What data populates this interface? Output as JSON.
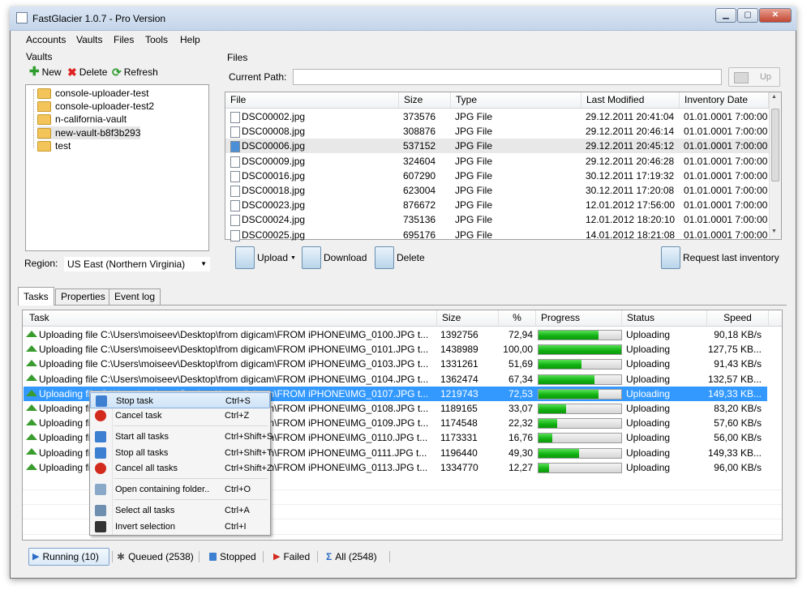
{
  "window": {
    "title": "FastGlacier 1.0.7 - Pro Version",
    "controls": {
      "minimize": "▁",
      "maximize": "▢",
      "close": "✕"
    }
  },
  "menu": [
    "Accounts",
    "Vaults",
    "Files",
    "Tools",
    "Help"
  ],
  "vaults": {
    "label": "Vaults",
    "toolbar": {
      "new": "New",
      "delete": "Delete",
      "refresh": "Refresh"
    },
    "items": [
      "console-uploader-test",
      "console-uploader-test2",
      "n-california-vault",
      "new-vault-b8f3b293",
      "test"
    ],
    "selected_index": 3,
    "region_label": "Region:",
    "region_value": "US East (Northern Virginia)"
  },
  "files": {
    "label": "Files",
    "current_path_label": "Current Path:",
    "current_path_value": "",
    "up_button": "Up",
    "columns": [
      "File",
      "Size",
      "Type",
      "Last Modified",
      "Inventory Date"
    ],
    "rows": [
      [
        "DSC00002.jpg",
        "373576",
        "JPG File",
        "29.12.2011 20:41:04",
        "01.01.0001 7:00:00"
      ],
      [
        "DSC00008.jpg",
        "308876",
        "JPG File",
        "29.12.2011 20:46:14",
        "01.01.0001 7:00:00"
      ],
      [
        "DSC00006.jpg",
        "537152",
        "JPG File",
        "29.12.2011 20:45:12",
        "01.01.0001 7:00:00"
      ],
      [
        "DSC00009.jpg",
        "324604",
        "JPG File",
        "29.12.2011 20:46:28",
        "01.01.0001 7:00:00"
      ],
      [
        "DSC00016.jpg",
        "607290",
        "JPG File",
        "30.12.2011 17:19:32",
        "01.01.0001 7:00:00"
      ],
      [
        "DSC00018.jpg",
        "623004",
        "JPG File",
        "30.12.2011 17:20:08",
        "01.01.0001 7:00:00"
      ],
      [
        "DSC00023.jpg",
        "876672",
        "JPG File",
        "12.01.2012 17:56:00",
        "01.01.0001 7:00:00"
      ],
      [
        "DSC00024.jpg",
        "735136",
        "JPG File",
        "12.01.2012 18:20:10",
        "01.01.0001 7:00:00"
      ],
      [
        "DSC00025.jpg",
        "695176",
        "JPG File",
        "14.01.2012 18:21:08",
        "01.01.0001 7:00:00"
      ]
    ],
    "selected_index": 2,
    "toolbar": {
      "upload": "Upload",
      "download": "Download",
      "delete": "Delete",
      "request_inventory": "Request last inventory"
    }
  },
  "tabs": [
    "Tasks",
    "Properties",
    "Event log"
  ],
  "tasks": {
    "columns": [
      "Task",
      "Size",
      "%",
      "Progress",
      "Status",
      "Speed"
    ],
    "rows": [
      {
        "task": "Uploading file C:\\Users\\moiseev\\Desktop\\from digicam\\FROM iPHONE\\IMG_0100.JPG t...",
        "size": "1392756",
        "pct": "72,94",
        "progress": 0.7294,
        "status": "Uploading",
        "speed": "90,18 KB/s"
      },
      {
        "task": "Uploading file C:\\Users\\moiseev\\Desktop\\from digicam\\FROM iPHONE\\IMG_0101.JPG t...",
        "size": "1438989",
        "pct": "100,00",
        "progress": 1.0,
        "status": "Uploading",
        "speed": "127,75 KB..."
      },
      {
        "task": "Uploading file C:\\Users\\moiseev\\Desktop\\from digicam\\FROM iPHONE\\IMG_0103.JPG t...",
        "size": "1331261",
        "pct": "51,69",
        "progress": 0.5169,
        "status": "Uploading",
        "speed": "91,43 KB/s"
      },
      {
        "task": "Uploading file C:\\Users\\moiseev\\Desktop\\from digicam\\FROM iPHONE\\IMG_0104.JPG t...",
        "size": "1362474",
        "pct": "67,34",
        "progress": 0.6734,
        "status": "Uploading",
        "speed": "132,57 KB..."
      },
      {
        "task": "Uploading file C:\\Users\\moiseev\\Desktop\\from digicam\\FROM iPHONE\\IMG_0107.JPG t...",
        "size": "1219743",
        "pct": "72,53",
        "progress": 0.7253,
        "status": "Uploading",
        "speed": "149,33 KB..."
      },
      {
        "task": "Uploading file C:\\Users\\moiseev\\Desktop\\from digicam\\FROM iPHONE\\IMG_0108.JPG t...",
        "size": "1189165",
        "pct": "33,07",
        "progress": 0.3307,
        "status": "Uploading",
        "speed": "83,20 KB/s"
      },
      {
        "task": "Uploading file C:\\Users\\moiseev\\Desktop\\from digicam\\FROM iPHONE\\IMG_0109.JPG t...",
        "size": "1174548",
        "pct": "22,32",
        "progress": 0.2232,
        "status": "Uploading",
        "speed": "57,60 KB/s"
      },
      {
        "task": "Uploading file C:\\Users\\moiseev\\Desktop\\from digicam\\FROM iPHONE\\IMG_0110.JPG t...",
        "size": "1173331",
        "pct": "16,76",
        "progress": 0.1676,
        "status": "Uploading",
        "speed": "56,00 KB/s"
      },
      {
        "task": "Uploading file C:\\Users\\moiseev\\Desktop\\from digicam\\FROM iPHONE\\IMG_0111.JPG t...",
        "size": "1196440",
        "pct": "49,30",
        "progress": 0.493,
        "status": "Uploading",
        "speed": "149,33 KB..."
      },
      {
        "task": "Uploading file C:\\Users\\moiseev\\Desktop\\from digicam\\FROM iPHONE\\IMG_0113.JPG t...",
        "size": "1334770",
        "pct": "12,27",
        "progress": 0.1227,
        "status": "Uploading",
        "speed": "96,00 KB/s"
      }
    ],
    "selected_index": 4
  },
  "context_menu": [
    {
      "label": "Stop task",
      "shortcut": "Ctrl+S",
      "icon": "stop-icon"
    },
    {
      "label": "Cancel task",
      "shortcut": "Ctrl+Z",
      "icon": "cancel-icon"
    },
    {
      "label": "Start all tasks",
      "shortcut": "Ctrl+Shift+S",
      "icon": "start-all-icon"
    },
    {
      "label": "Stop all tasks",
      "shortcut": "Ctrl+Shift+T",
      "icon": "stop-all-icon"
    },
    {
      "label": "Cancel all tasks",
      "shortcut": "Ctrl+Shift+Z",
      "icon": "cancel-all-icon"
    },
    {
      "label": "Open containing folder..",
      "shortcut": "Ctrl+O",
      "icon": "folder-icon"
    },
    {
      "label": "Select all tasks",
      "shortcut": "Ctrl+A",
      "icon": "select-all-icon"
    },
    {
      "label": "Invert selection",
      "shortcut": "Ctrl+I",
      "icon": "invert-icon"
    }
  ],
  "statusbar": {
    "running": "Running (10)",
    "queued": "Queued (2538)",
    "stopped": "Stopped",
    "failed": "Failed",
    "all": "All (2548)"
  },
  "colors": {
    "selection": "#3399ff",
    "progress": "#10b010",
    "accent": "#3a9c2e"
  }
}
